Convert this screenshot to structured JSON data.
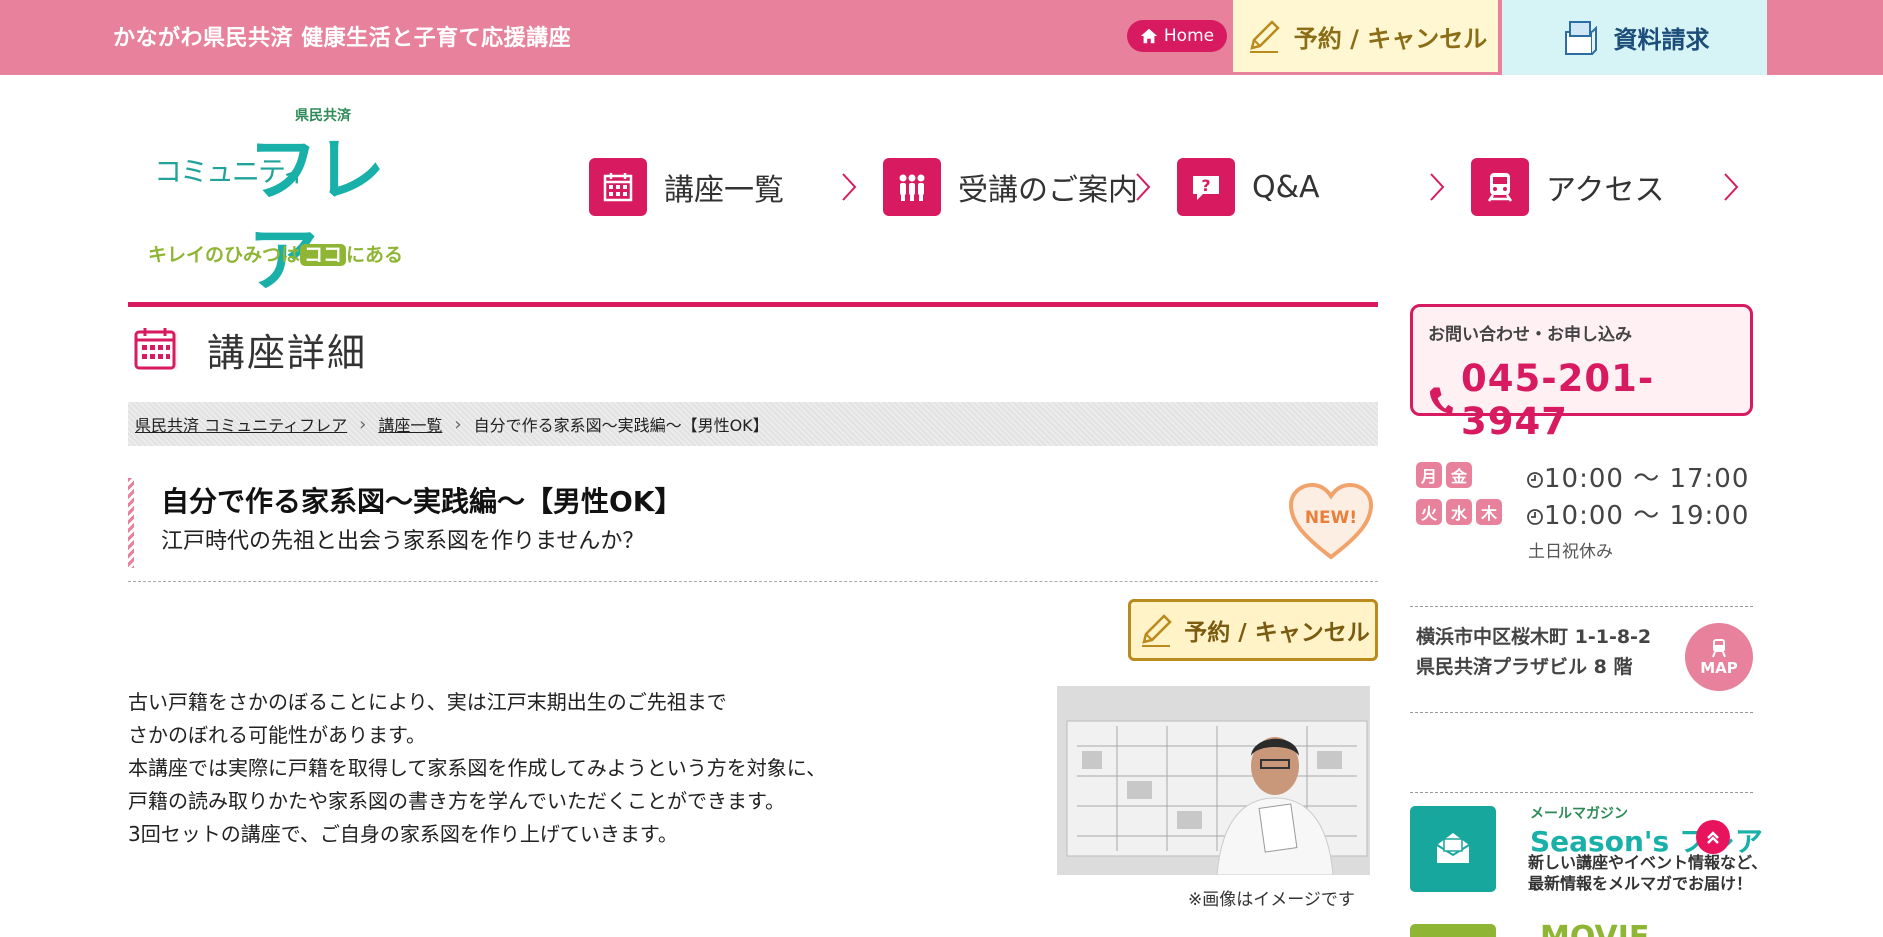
{
  "topbar": {
    "site_title": "かながわ県民共済 健康生活と子育て応援講座",
    "home_label": "Home",
    "reserve_label": "予約 / キャンセル",
    "docs_label": "資料請求"
  },
  "logo": {
    "top": "県民共済",
    "community": "コミュニティ",
    "main": "フレア",
    "tag_pre": "キレイのひみつは",
    "tag_koko": "ココ",
    "tag_post": "にある"
  },
  "nav": {
    "items": [
      {
        "label": "講座一覧",
        "icon": "calendar-icon"
      },
      {
        "label": "受講のご案内",
        "icon": "people-icon"
      },
      {
        "label": "Q&A",
        "icon": "question-icon"
      },
      {
        "label": "アクセス",
        "icon": "train-icon"
      }
    ]
  },
  "page": {
    "title": "講座詳細"
  },
  "breadcrumb": {
    "items": [
      "県民共済 コミュニティフレア",
      "講座一覧",
      "自分で作る家系図～実践編～【男性OK】"
    ]
  },
  "course": {
    "title": "自分で作る家系図～実践編～【男性OK】",
    "subtitle": "江戸時代の先祖と出会う家系図を作りませんか？",
    "badge": "NEW!",
    "reserve_label": "予約 / キャンセル",
    "description": [
      "古い戸籍をさかのぼることにより、実は江戸末期出生のご先祖まで",
      "さかのぼれる可能性があります。",
      "本講座では実際に戸籍を取得して家系図を作成してみようという方を対象に、",
      "戸籍の読み取りかたや家系図の書き方を学んでいただくことができます。",
      "3回セットの講座で、ご自身の家系図を作り上げていきます。"
    ],
    "photo_caption": "※画像はイメージです"
  },
  "sidebar": {
    "contact_label": "お問い合わせ・お申し込み",
    "phone": "045-201-3947",
    "hours": [
      {
        "days": [
          "月",
          "金"
        ],
        "time": "10:00 ～ 17:00"
      },
      {
        "days": [
          "火",
          "水",
          "木"
        ],
        "time": "10:00 ～ 19:00"
      }
    ],
    "closed_note": "土日祝休み",
    "address_line1": "横浜市中区桜木町 1-1-8-2",
    "address_line2": "県民共済プラザビル 8 階",
    "map_label": "MAP",
    "mail_small": "メールマガジン",
    "mail_title": "Season's フレア",
    "mail_desc_1": "新しい講座やイベント情報など、",
    "mail_desc_2": "最新情報をメルマガでお届け！",
    "movie_label": "MOVIE"
  },
  "colors": {
    "topbar": "#e8819c",
    "accent": "#d81b60",
    "teal": "#18b0a8",
    "green": "#8fb534"
  }
}
